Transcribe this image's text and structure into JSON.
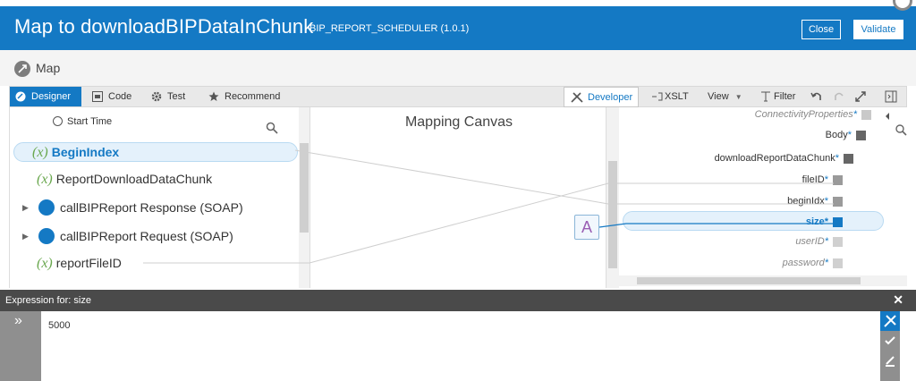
{
  "header": {
    "title": "Map to downloadBIPDataInChunk",
    "subtitle": "BIP_REPORT_SCHEDULER (1.0.1)",
    "close_label": "Close",
    "validate_label": "Validate"
  },
  "map_section": {
    "label": "Map"
  },
  "toolbar": {
    "tabs": [
      {
        "label": "Designer",
        "icon": "designer-icon"
      },
      {
        "label": "Code",
        "icon": "code-icon"
      },
      {
        "label": "Test",
        "icon": "gear-icon"
      },
      {
        "label": "Recommend",
        "icon": "star-icon"
      }
    ],
    "developer_label": "Developer",
    "xslt_label": "XSLT",
    "view_label": "View",
    "filter_label": "Filter"
  },
  "source_tree": {
    "items": [
      {
        "label": "Start Time"
      },
      {
        "label": "BeginIndex",
        "prefix": "(x)"
      },
      {
        "label": "ReportDownloadDataChunk",
        "prefix": "(x)"
      },
      {
        "label": "callBIPReport Response (SOAP)"
      },
      {
        "label": "callBIPReport Request (SOAP)"
      },
      {
        "label": "reportFileID",
        "prefix": "(x)"
      }
    ]
  },
  "canvas": {
    "title": "Mapping Canvas",
    "function_box": "A"
  },
  "target_tree": {
    "items": [
      {
        "label": "ConnectivityProperties",
        "req": "*"
      },
      {
        "label": "Body",
        "req": "*"
      },
      {
        "label": "downloadReportDataChunk",
        "req": "*"
      },
      {
        "label": "fileID",
        "req": "*"
      },
      {
        "label": "beginIdx",
        "req": "*"
      },
      {
        "label": "size",
        "req": "*"
      },
      {
        "label": "userID",
        "req": "*"
      },
      {
        "label": "password",
        "req": "*"
      }
    ]
  },
  "expression": {
    "header": "Expression for: size",
    "value": "5000"
  },
  "colors": {
    "brand": "#1479c4",
    "variable": "#6aa84f"
  }
}
